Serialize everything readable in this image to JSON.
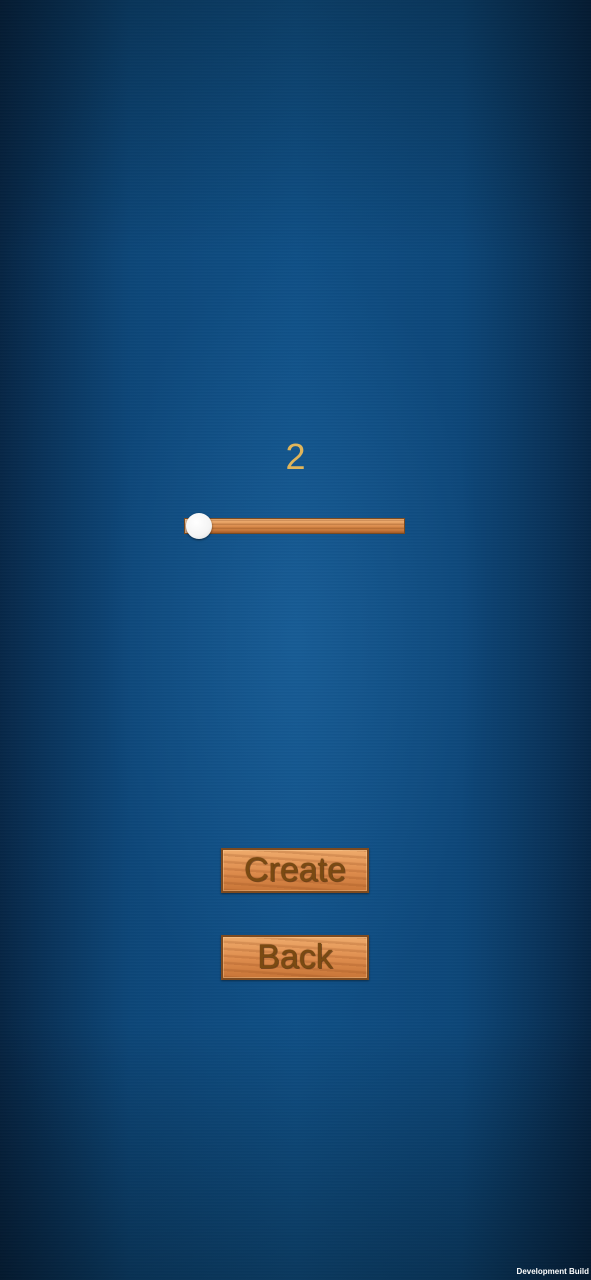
{
  "player_count": {
    "label": "2",
    "value": 2,
    "fraction": 0.07
  },
  "buttons": {
    "create_label": "Create",
    "back_label": "Back"
  },
  "footer": {
    "build_label": "Development Build"
  },
  "colors": {
    "background": "#0f5288",
    "label_gold": "#e0b55a",
    "wood": "#df8e4f",
    "button_text": "#7a4a12"
  }
}
